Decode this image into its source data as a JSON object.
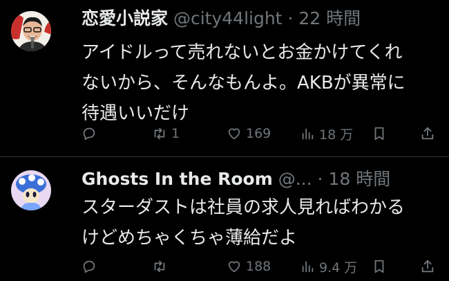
{
  "tweets": [
    {
      "display_name": "恋愛小説家",
      "handle": "@city44light",
      "separator": "·",
      "time": "22 時間",
      "text": "アイドルって売れないとお金かけてくれ\nないから、そんなもんよ。AKBが異常に\n待遇いいだけ",
      "actions": {
        "reply_count": "",
        "retweet_count": "1",
        "like_count": "169",
        "view_count": "18 万"
      },
      "avatar_colors": {
        "bg": "#f2efe8",
        "accent": "#c8302c"
      }
    },
    {
      "display_name": "Ghosts In the Room",
      "handle": "@...",
      "separator": "·",
      "time": "18 時間",
      "text": "スターダストは社員の求人見ればわかる\nけどめちゃくちゃ薄給だよ",
      "actions": {
        "reply_count": "",
        "retweet_count": "",
        "like_count": "188",
        "view_count": "9.4 万"
      },
      "avatar_colors": {
        "bg": "#e9d8f2",
        "accent": "#3a6fd8"
      }
    }
  ]
}
